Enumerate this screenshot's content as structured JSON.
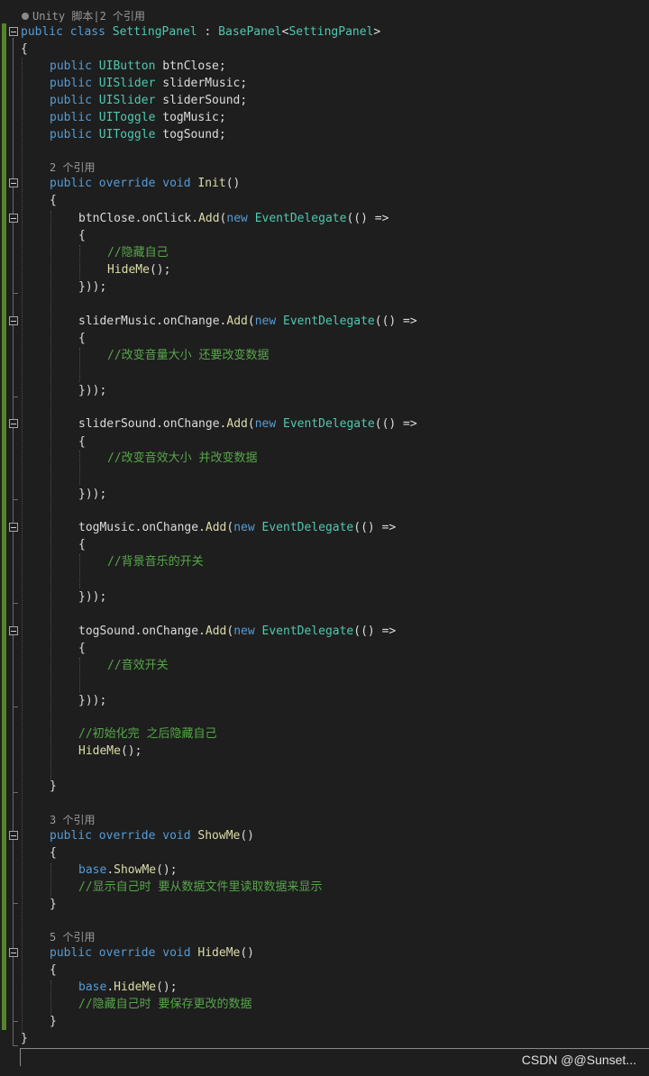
{
  "codelens": {
    "class_refs": "Unity 脚本|2 个引用",
    "init_refs": "2 个引用",
    "showme_refs": "3 个引用",
    "hideme_refs": "5 个引用"
  },
  "code": {
    "class_decl": [
      {
        "t": "public",
        "c": "kw"
      },
      {
        "t": " ",
        "c": "pl"
      },
      {
        "t": "class",
        "c": "kw"
      },
      {
        "t": " ",
        "c": "pl"
      },
      {
        "t": "SettingPanel",
        "c": "ty"
      },
      {
        "t": " : ",
        "c": "pl"
      },
      {
        "t": "BasePanel",
        "c": "ty"
      },
      {
        "t": "<",
        "c": "pl"
      },
      {
        "t": "SettingPanel",
        "c": "ty"
      },
      {
        "t": ">",
        "c": "pl"
      }
    ],
    "open_class": [
      {
        "t": "{",
        "c": "pl"
      }
    ],
    "field_btnclose": [
      {
        "t": "public",
        "c": "kw"
      },
      {
        "t": " ",
        "c": "pl"
      },
      {
        "t": "UIButton",
        "c": "ty"
      },
      {
        "t": " btnClose;",
        "c": "pl"
      }
    ],
    "field_slidermusic": [
      {
        "t": "public",
        "c": "kw"
      },
      {
        "t": " ",
        "c": "pl"
      },
      {
        "t": "UISlider",
        "c": "ty"
      },
      {
        "t": " sliderMusic;",
        "c": "pl"
      }
    ],
    "field_slidersound": [
      {
        "t": "public",
        "c": "kw"
      },
      {
        "t": " ",
        "c": "pl"
      },
      {
        "t": "UISlider",
        "c": "ty"
      },
      {
        "t": " sliderSound;",
        "c": "pl"
      }
    ],
    "field_togmusic": [
      {
        "t": "public",
        "c": "kw"
      },
      {
        "t": " ",
        "c": "pl"
      },
      {
        "t": "UIToggle",
        "c": "ty"
      },
      {
        "t": " togMusic;",
        "c": "pl"
      }
    ],
    "field_togsound": [
      {
        "t": "public",
        "c": "kw"
      },
      {
        "t": " ",
        "c": "pl"
      },
      {
        "t": "UIToggle",
        "c": "ty"
      },
      {
        "t": " togSound;",
        "c": "pl"
      }
    ],
    "init_decl": [
      {
        "t": "public",
        "c": "kw"
      },
      {
        "t": " ",
        "c": "pl"
      },
      {
        "t": "override",
        "c": "kw"
      },
      {
        "t": " ",
        "c": "pl"
      },
      {
        "t": "void",
        "c": "kw"
      },
      {
        "t": " ",
        "c": "pl"
      },
      {
        "t": "Init",
        "c": "mt"
      },
      {
        "t": "()",
        "c": "pl"
      }
    ],
    "open_brace": [
      {
        "t": "{",
        "c": "pl"
      }
    ],
    "close_brace": [
      {
        "t": "}",
        "c": "pl"
      }
    ],
    "close_lambda": [
      {
        "t": "}));",
        "c": "pl"
      }
    ],
    "btnclose_add": [
      {
        "t": "btnClose.onClick.",
        "c": "pl"
      },
      {
        "t": "Add",
        "c": "mt"
      },
      {
        "t": "(",
        "c": "pl"
      },
      {
        "t": "new",
        "c": "kw"
      },
      {
        "t": " ",
        "c": "pl"
      },
      {
        "t": "EventDelegate",
        "c": "ty"
      },
      {
        "t": "(() =>",
        "c": "pl"
      }
    ],
    "comment_hide_self": [
      {
        "t": "//隐藏自己",
        "c": "cm"
      }
    ],
    "hideme_call": [
      {
        "t": "HideMe",
        "c": "mt"
      },
      {
        "t": "();",
        "c": "pl"
      }
    ],
    "slidermusic_add": [
      {
        "t": "sliderMusic.onChange.",
        "c": "pl"
      },
      {
        "t": "Add",
        "c": "mt"
      },
      {
        "t": "(",
        "c": "pl"
      },
      {
        "t": "new",
        "c": "kw"
      },
      {
        "t": " ",
        "c": "pl"
      },
      {
        "t": "EventDelegate",
        "c": "ty"
      },
      {
        "t": "(() =>",
        "c": "pl"
      }
    ],
    "comment_music": [
      {
        "t": "//改变音量大小 还要改变数据",
        "c": "cm"
      }
    ],
    "slidersound_add": [
      {
        "t": "sliderSound.onChange.",
        "c": "pl"
      },
      {
        "t": "Add",
        "c": "mt"
      },
      {
        "t": "(",
        "c": "pl"
      },
      {
        "t": "new",
        "c": "kw"
      },
      {
        "t": " ",
        "c": "pl"
      },
      {
        "t": "EventDelegate",
        "c": "ty"
      },
      {
        "t": "(() =>",
        "c": "pl"
      }
    ],
    "comment_sound": [
      {
        "t": "//改变音效大小 并改变数据",
        "c": "cm"
      }
    ],
    "togmusic_add": [
      {
        "t": "togMusic.onChange.",
        "c": "pl"
      },
      {
        "t": "Add",
        "c": "mt"
      },
      {
        "t": "(",
        "c": "pl"
      },
      {
        "t": "new",
        "c": "kw"
      },
      {
        "t": " ",
        "c": "pl"
      },
      {
        "t": "EventDelegate",
        "c": "ty"
      },
      {
        "t": "(() =>",
        "c": "pl"
      }
    ],
    "comment_bgm": [
      {
        "t": "//背景音乐的开关",
        "c": "cm"
      }
    ],
    "togsound_add": [
      {
        "t": "togSound.onChange.",
        "c": "pl"
      },
      {
        "t": "Add",
        "c": "mt"
      },
      {
        "t": "(",
        "c": "pl"
      },
      {
        "t": "new",
        "c": "kw"
      },
      {
        "t": " ",
        "c": "pl"
      },
      {
        "t": "EventDelegate",
        "c": "ty"
      },
      {
        "t": "(() =>",
        "c": "pl"
      }
    ],
    "comment_sfx": [
      {
        "t": "//音效开关",
        "c": "cm"
      }
    ],
    "comment_init_done": [
      {
        "t": "//初始化完 之后隐藏自己",
        "c": "cm"
      }
    ],
    "showme_decl": [
      {
        "t": "public",
        "c": "kw"
      },
      {
        "t": " ",
        "c": "pl"
      },
      {
        "t": "override",
        "c": "kw"
      },
      {
        "t": " ",
        "c": "pl"
      },
      {
        "t": "void",
        "c": "kw"
      },
      {
        "t": " ",
        "c": "pl"
      },
      {
        "t": "ShowMe",
        "c": "mt"
      },
      {
        "t": "()",
        "c": "pl"
      }
    ],
    "base_showme": [
      {
        "t": "base",
        "c": "kw"
      },
      {
        "t": ".",
        "c": "pl"
      },
      {
        "t": "ShowMe",
        "c": "mt"
      },
      {
        "t": "();",
        "c": "pl"
      }
    ],
    "comment_showme": [
      {
        "t": "//显示自己时 要从数据文件里读取数据来显示",
        "c": "cm"
      }
    ],
    "hideme_decl": [
      {
        "t": "public",
        "c": "kw"
      },
      {
        "t": " ",
        "c": "pl"
      },
      {
        "t": "override",
        "c": "kw"
      },
      {
        "t": " ",
        "c": "pl"
      },
      {
        "t": "void",
        "c": "kw"
      },
      {
        "t": " ",
        "c": "pl"
      },
      {
        "t": "HideMe",
        "c": "mt"
      },
      {
        "t": "()",
        "c": "pl"
      }
    ],
    "base_hideme": [
      {
        "t": "base",
        "c": "kw"
      },
      {
        "t": ".",
        "c": "pl"
      },
      {
        "t": "HideMe",
        "c": "mt"
      },
      {
        "t": "();",
        "c": "pl"
      }
    ],
    "comment_hideme": [
      {
        "t": "//隐藏自己时 要保存更改的数据",
        "c": "cm"
      }
    ]
  },
  "watermark": "CSDN @@Sunset...",
  "colors": {
    "background": "#1e1e1e",
    "keyword": "#569cd6",
    "type": "#4ec9b0",
    "method": "#dcdcaa",
    "comment": "#57a64a",
    "plain": "#dcdcdc",
    "codelens": "#999999",
    "change_bar": "#55852a"
  }
}
